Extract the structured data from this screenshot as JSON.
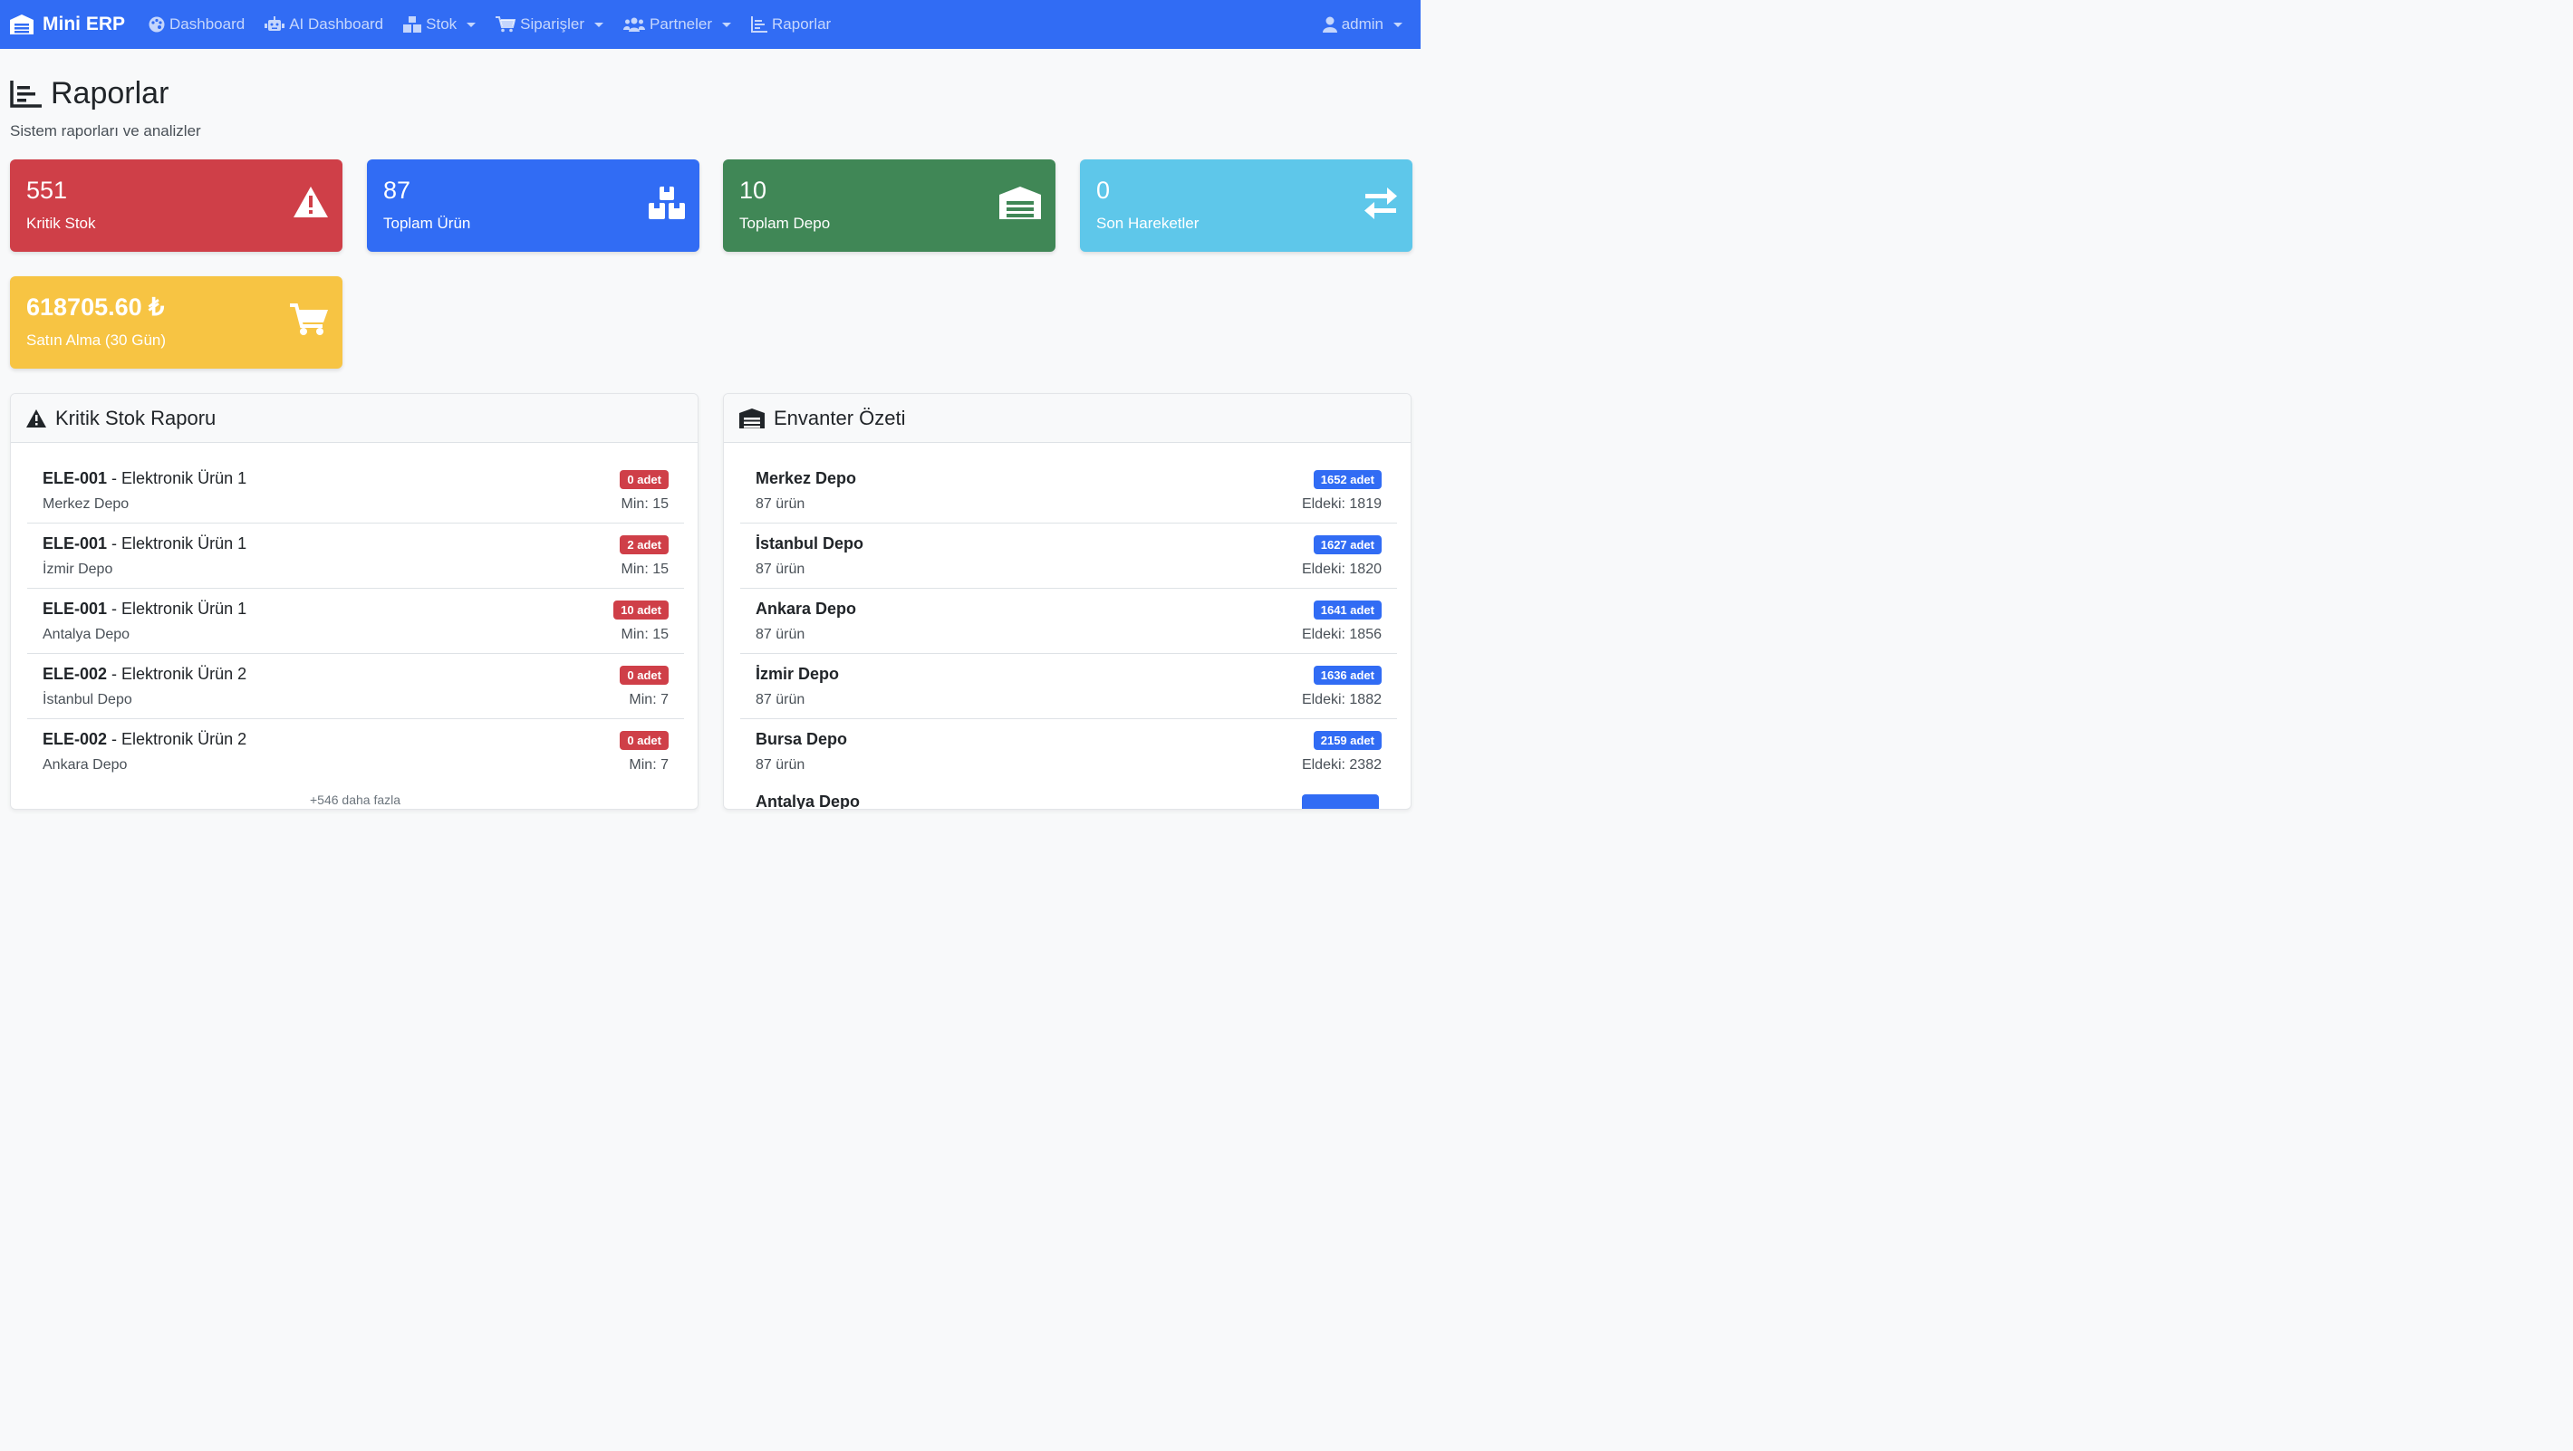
{
  "nav": {
    "brand": "Mini ERP",
    "items": [
      {
        "label": "Dashboard",
        "icon": "palette-icon"
      },
      {
        "label": "AI Dashboard",
        "icon": "robot-icon"
      },
      {
        "label": "Stok",
        "icon": "boxes-icon"
      },
      {
        "label": "Siparişler",
        "icon": "cart-icon"
      },
      {
        "label": "Partneler",
        "icon": "users-icon"
      },
      {
        "label": "Raporlar",
        "icon": "chart-icon"
      }
    ],
    "user": "admin"
  },
  "page": {
    "title": "Raporlar",
    "subtitle": "Sistem raporları ve analizler"
  },
  "stats": [
    {
      "value": "551",
      "label": "Kritik Stok",
      "icon": "warning-icon",
      "color": "#cf3f48"
    },
    {
      "value": "87",
      "label": "Toplam Ürün",
      "icon": "boxes-icon",
      "color": "#316cf4"
    },
    {
      "value": "10",
      "label": "Toplam Depo",
      "icon": "warehouse-icon",
      "color": "#408756"
    },
    {
      "value": "0",
      "label": "Son Hareketler",
      "icon": "exchange-icon",
      "color": "#5ec7ea"
    },
    {
      "value": "618705.60 ₺",
      "label": "Satın Alma (30 Gün)",
      "icon": "cart-icon",
      "color": "#f7c443"
    }
  ],
  "critical": {
    "title": "Kritik Stok Raporu",
    "rows": [
      {
        "code": "ELE-001",
        "name": " - Elektronik Ürün 1",
        "depot": "Merkez Depo",
        "badge": "0 adet",
        "min": "Min: 15"
      },
      {
        "code": "ELE-001",
        "name": " - Elektronik Ürün 1",
        "depot": "İzmir Depo",
        "badge": "2 adet",
        "min": "Min: 15"
      },
      {
        "code": "ELE-001",
        "name": " - Elektronik Ürün 1",
        "depot": "Antalya Depo",
        "badge": "10 adet",
        "min": "Min: 15"
      },
      {
        "code": "ELE-002",
        "name": " - Elektronik Ürün 2",
        "depot": "İstanbul Depo",
        "badge": "0 adet",
        "min": "Min: 7"
      },
      {
        "code": "ELE-002",
        "name": " - Elektronik Ürün 2",
        "depot": "Ankara Depo",
        "badge": "0 adet",
        "min": "Min: 7"
      }
    ],
    "more": "+546 daha fazla"
  },
  "inventory": {
    "title": "Envanter Özeti",
    "rows": [
      {
        "depot": "Merkez Depo",
        "count": "87 ürün",
        "badge": "1652 adet",
        "hand": "Eldeki: 1819"
      },
      {
        "depot": "İstanbul Depo",
        "count": "87 ürün",
        "badge": "1627 adet",
        "hand": "Eldeki: 1820"
      },
      {
        "depot": "Ankara Depo",
        "count": "87 ürün",
        "badge": "1641 adet",
        "hand": "Eldeki: 1856"
      },
      {
        "depot": "İzmir Depo",
        "count": "87 ürün",
        "badge": "1636 adet",
        "hand": "Eldeki: 1882"
      },
      {
        "depot": "Bursa Depo",
        "count": "87 ürün",
        "badge": "2159 adet",
        "hand": "Eldeki: 2382"
      }
    ],
    "partial": "Antalya Depo"
  }
}
